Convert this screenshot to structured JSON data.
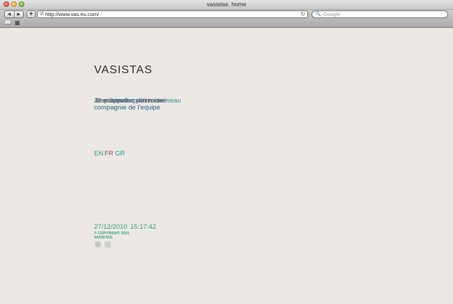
{
  "window": {
    "title": "vasistas. home"
  },
  "toolbar": {
    "back_icon": "back-arrow-icon",
    "forward_icon": "forward-arrow-icon",
    "add_icon": "plus-icon",
    "url": "http://www.vas.eu.com/",
    "search_placeholder": "Google"
  },
  "bookmarks": {
    "icons": [
      "book-icon",
      "grid-icon"
    ]
  },
  "page": {
    "logo": "VASISTAS",
    "overlapping_text_lines": [
      "Je m’appelle patrimoine",
      "The domaine patrimoine",
      "Le patrimoine de mon réseau",
      "compagnie de l’equipe"
    ],
    "languages": [
      {
        "code": "EN",
        "color": "#2f9b6d"
      },
      {
        "code": "FR",
        "color": "#7d3d75"
      },
      {
        "code": "GR",
        "color": "#2d8f99"
      }
    ],
    "date": "27/12/2010",
    "time": "15:17:42",
    "copyright_line1": "© COPYRIGHT 2010",
    "copyright_line2": "VASISTAS."
  }
}
